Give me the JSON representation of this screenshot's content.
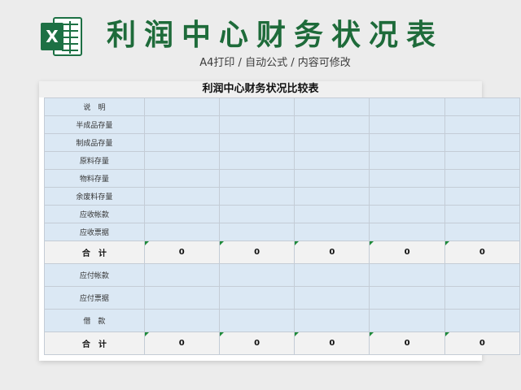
{
  "header": {
    "title": "利润中心财务状况表",
    "subtitle": "A4打印 / 自动公式 / 内容可修改"
  },
  "sheet": {
    "title": "利润中心财务状况比较表",
    "rows_group1": [
      "说　明",
      "半成品存量",
      "制成品存量",
      "原料存量",
      "物料存量",
      "余废料存量",
      "应收帐款",
      "应收票据"
    ],
    "total_label": "合　计",
    "totals1": [
      "0",
      "0",
      "0",
      "0",
      "0"
    ],
    "rows_group2": [
      "应付帐款",
      "应付票据",
      "借　款"
    ],
    "totals2": [
      "0",
      "0",
      "0",
      "0",
      "0"
    ]
  },
  "colors": {
    "title_green": "#1e6b3a",
    "excel_green": "#1d7044",
    "cell_blue": "#dbe8f4",
    "total_gray": "#f2f2f2"
  },
  "icons": {
    "logo": "excel-icon"
  }
}
